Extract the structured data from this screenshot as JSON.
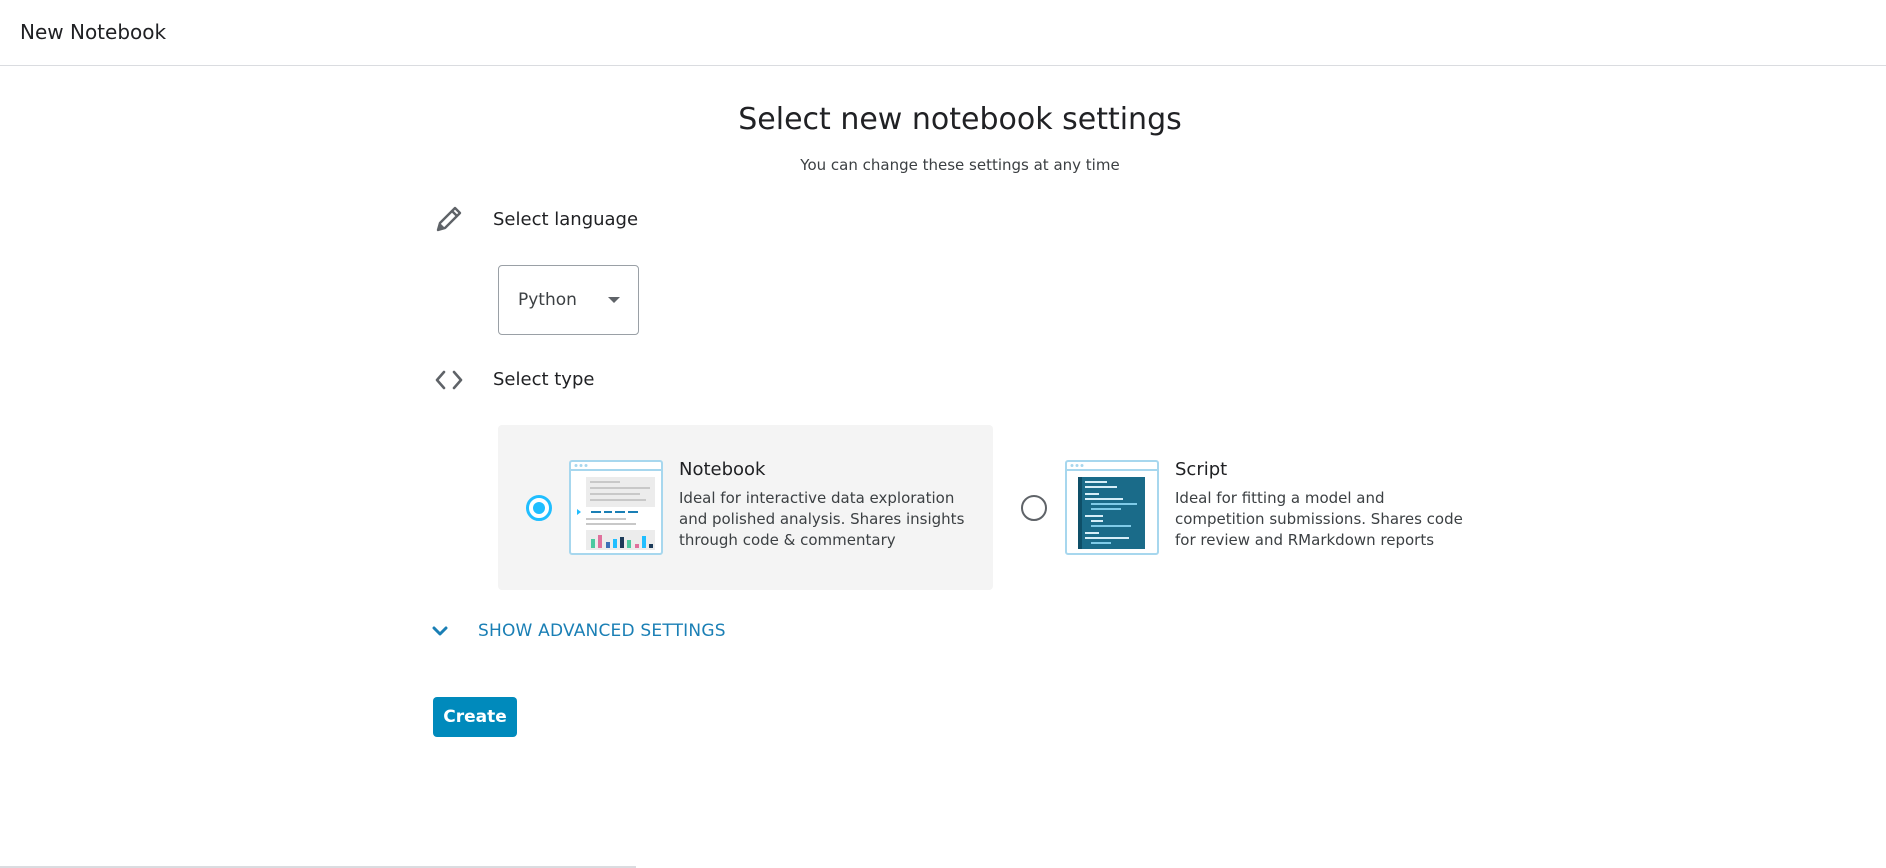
{
  "header": {
    "title": "New Notebook"
  },
  "main": {
    "title": "Select new notebook settings",
    "subtitle": "You can change these settings at any time"
  },
  "language": {
    "label": "Select language",
    "icon": "pencil-icon",
    "selected": "Python"
  },
  "type": {
    "label": "Select type",
    "icon": "code-brackets-icon",
    "options": [
      {
        "title": "Notebook",
        "description": "Ideal for interactive data exploration and polished analysis. Shares insights through code & commentary",
        "selected": true
      },
      {
        "title": "Script",
        "description": "Ideal for fitting a model and competition submissions. Shares code for review and RMarkdown reports",
        "selected": false
      }
    ]
  },
  "advanced": {
    "label": "SHOW ADVANCED SETTINGS"
  },
  "actions": {
    "create_label": "Create"
  },
  "colors": {
    "accent": "#20beff",
    "primary_button": "#008abc",
    "link": "#1a7fb5",
    "card_selected_bg": "#f4f4f4"
  }
}
